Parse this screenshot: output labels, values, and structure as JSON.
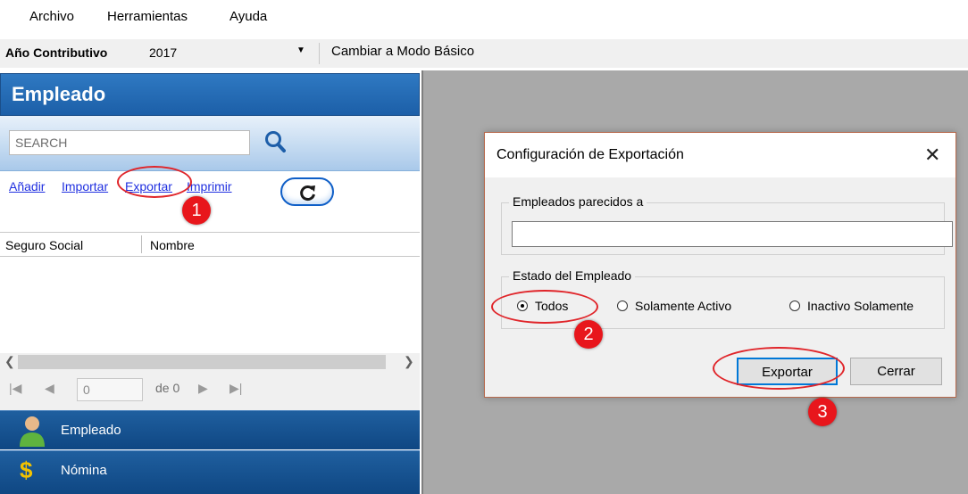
{
  "menu": [
    "Archivo",
    "Herramientas",
    "Ayuda"
  ],
  "toolbar": {
    "tax_year_label": "Año Contributivo",
    "tax_year_value": "2017",
    "mode_button": "Cambiar a Modo Básico"
  },
  "left_panel": {
    "title": "Empleado",
    "search_placeholder": "SEARCH",
    "links": [
      "Añadir",
      "Importar",
      "Exportar",
      "Imprimir"
    ],
    "columns": [
      "Seguro Social",
      "Nombre"
    ],
    "pager": {
      "page_value": "0",
      "of_label": "de 0"
    },
    "nav": [
      "Empleado",
      "Nómina"
    ]
  },
  "dialog": {
    "title": "Configuración de Exportación",
    "similar_group_label": "Empleados parecidos a",
    "status_group_label": "Estado del Empleado",
    "radios": [
      "Todos",
      "Solamente Activo",
      "Inactivo Solamente"
    ],
    "selected_radio": "Todos",
    "export_button": "Exportar",
    "close_button": "Cerrar"
  },
  "annotations": [
    "1",
    "2",
    "3"
  ],
  "colors": {
    "header_blue": "#1c5fa8",
    "link_blue": "#1f2fe0",
    "annotation_red": "#e8161c",
    "workspace_gray": "#a9a9a9"
  }
}
